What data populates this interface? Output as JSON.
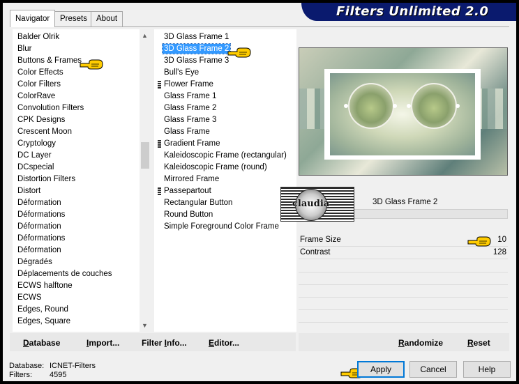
{
  "window": {
    "title": "Filters Unlimited 2.0"
  },
  "tabs": [
    {
      "label": "Navigator",
      "active": true
    },
    {
      "label": "Presets",
      "active": false
    },
    {
      "label": "About",
      "active": false
    }
  ],
  "categories": [
    "Balder Olrik",
    "Blur",
    "Buttons & Frames",
    "Color Effects",
    "Color Filters",
    "ColorRave",
    "Convolution Filters",
    "CPK Designs",
    "Crescent Moon",
    "Cryptology",
    "DC Layer",
    "DCspecial",
    "Distortion Filters",
    "Distort",
    "Déformation",
    "Déformations",
    "Déformation",
    "Déformations",
    "Déformation",
    "Dégradés",
    "Déplacements de couches",
    "ECWS halftone",
    "ECWS",
    "Edges, Round",
    "Edges, Square"
  ],
  "selected_category": "Buttons & Frames",
  "filters": [
    {
      "label": "3D Glass Frame 1",
      "group": false
    },
    {
      "label": "3D Glass Frame 2",
      "group": false,
      "selected": true
    },
    {
      "label": "3D Glass Frame 3",
      "group": false
    },
    {
      "label": "Bull's Eye",
      "group": false
    },
    {
      "label": "Flower Frame",
      "group": true
    },
    {
      "label": "Glass Frame 1",
      "group": false
    },
    {
      "label": "Glass Frame 2",
      "group": false
    },
    {
      "label": "Glass Frame 3",
      "group": false
    },
    {
      "label": "Glass Frame",
      "group": false
    },
    {
      "label": "Gradient Frame",
      "group": true
    },
    {
      "label": "Kaleidoscopic Frame (rectangular)",
      "group": false
    },
    {
      "label": "Kaleidoscopic Frame (round)",
      "group": false
    },
    {
      "label": "Mirrored Frame",
      "group": false
    },
    {
      "label": "Passepartout",
      "group": true
    },
    {
      "label": "Rectangular Button",
      "group": false
    },
    {
      "label": "Round Button",
      "group": false
    },
    {
      "label": "Simple Foreground Color Frame",
      "group": false
    }
  ],
  "current_filter": "3D Glass Frame 2",
  "watermark": "claudia",
  "params": [
    {
      "label": "Frame Size",
      "value": "10"
    },
    {
      "label": "Contrast",
      "value": "128"
    }
  ],
  "left_toolbar": {
    "database": {
      "u": "D",
      "rest": "atabase"
    },
    "import": {
      "u": "I",
      "rest": "mport..."
    },
    "filter_info": {
      "pre": "Filter ",
      "u": "I",
      "rest": "nfo..."
    },
    "editor": {
      "u": "E",
      "rest": "ditor..."
    }
  },
  "right_toolbar": {
    "randomize": {
      "u": "R",
      "rest": "andomize"
    },
    "reset": {
      "u": "R",
      "rest": "eset"
    }
  },
  "status": {
    "database_label": "Database:",
    "database_value": "ICNET-Filters",
    "filters_label": "Filters:",
    "filters_value": "4595"
  },
  "buttons": {
    "apply": "Apply",
    "cancel": "Cancel",
    "help": "Help"
  },
  "colors": {
    "banner": "#0a1a6e",
    "selection": "#3399ff",
    "hand": "#ffcc00"
  }
}
